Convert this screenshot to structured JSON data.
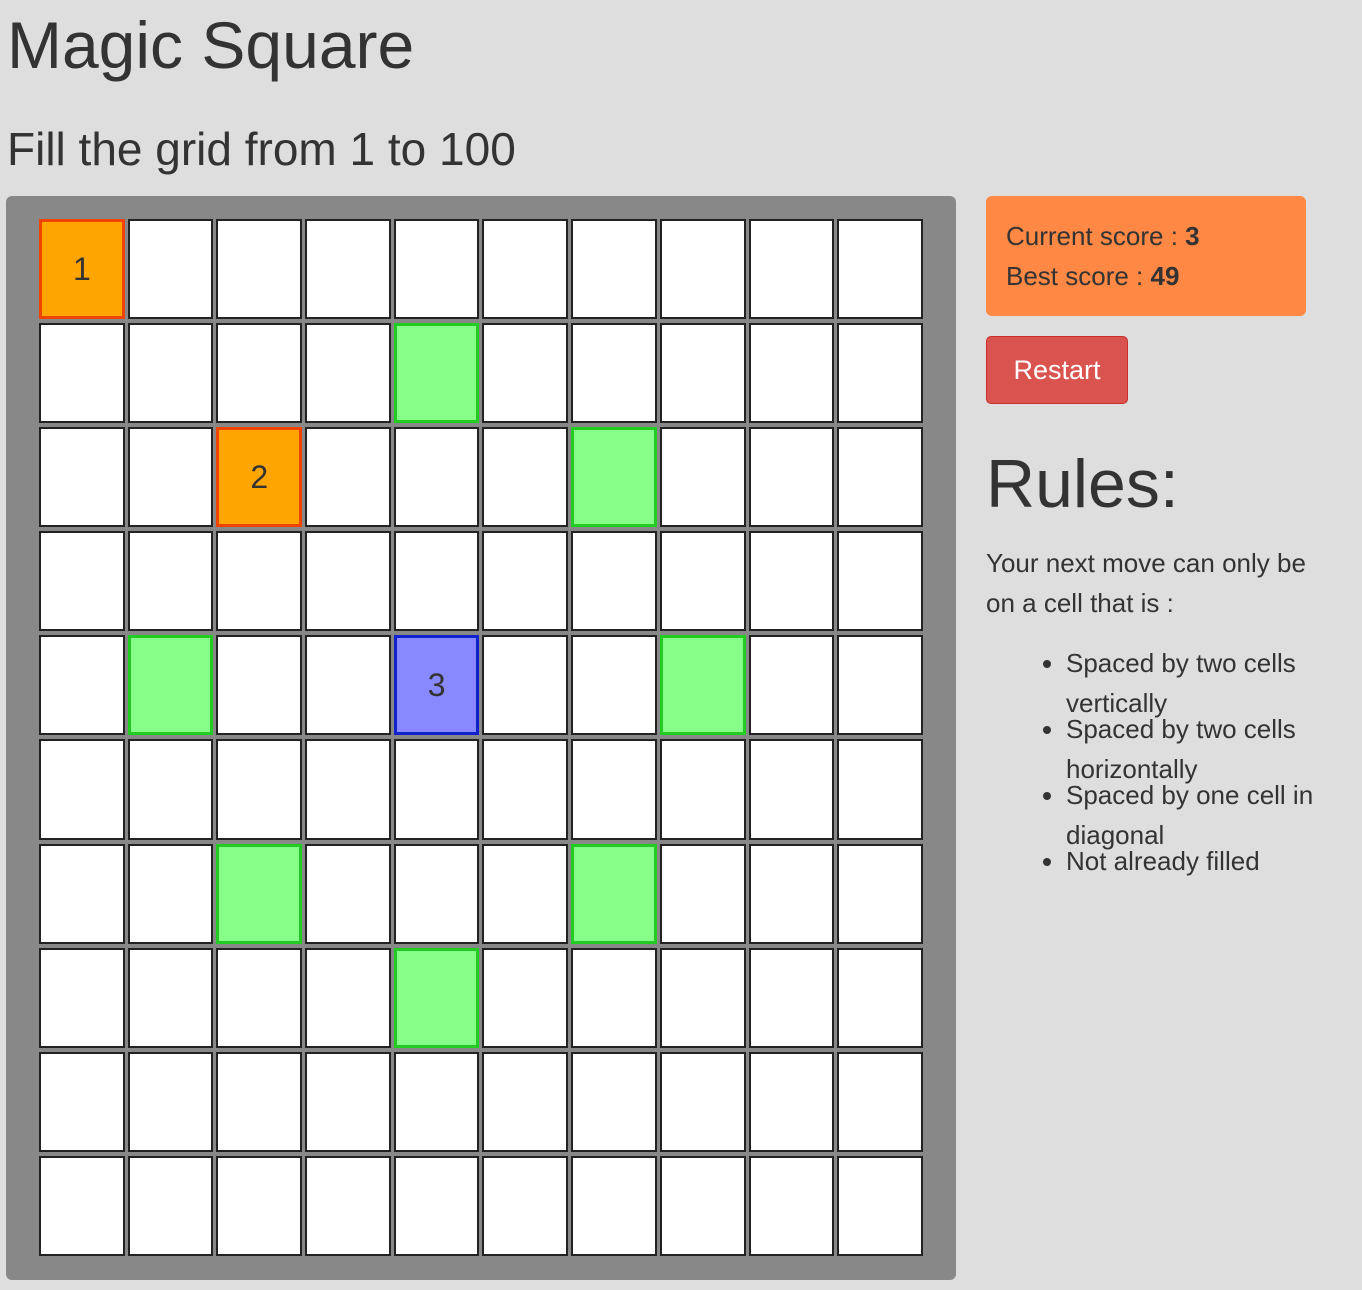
{
  "header": {
    "title": "Magic Square",
    "subtitle": "Fill the grid from 1 to 100"
  },
  "score": {
    "current_label": "Current score : ",
    "current_value": "3",
    "best_label": "Best score : ",
    "best_value": "49"
  },
  "controls": {
    "restart_label": "Restart"
  },
  "rules": {
    "title": "Rules:",
    "intro": "Your next move can only be on a cell that is :",
    "items": [
      "Spaced by two cells vertically",
      "Spaced by two cells horizontally",
      "Spaced by one cell in diagonal",
      "Not already filled"
    ]
  },
  "colors": {
    "background": "#dedede",
    "board": "#888888",
    "filled": "#ffa500",
    "filled_border": "#ee4400",
    "current": "#8888ff",
    "current_border": "#1122cc",
    "possible": "#88ff88",
    "possible_border": "#22cc22",
    "score_box": "#ff8844",
    "restart": "#d9534f"
  },
  "grid": {
    "size": 10,
    "filled": [
      {
        "row": 0,
        "col": 0,
        "value": "1"
      },
      {
        "row": 2,
        "col": 2,
        "value": "2"
      }
    ],
    "current": {
      "row": 4,
      "col": 4,
      "value": "3"
    },
    "possible": [
      {
        "row": 1,
        "col": 4
      },
      {
        "row": 2,
        "col": 6
      },
      {
        "row": 4,
        "col": 1
      },
      {
        "row": 4,
        "col": 7
      },
      {
        "row": 6,
        "col": 2
      },
      {
        "row": 6,
        "col": 6
      },
      {
        "row": 7,
        "col": 4
      }
    ]
  }
}
